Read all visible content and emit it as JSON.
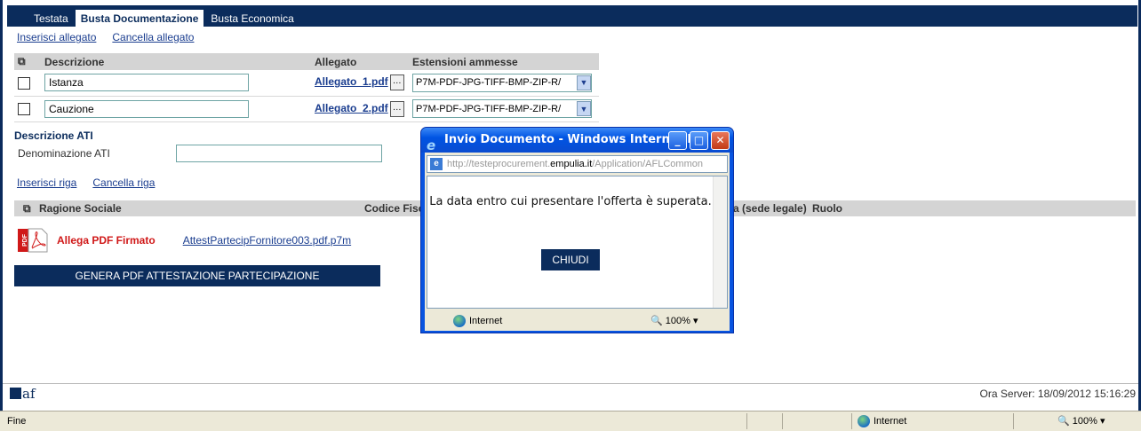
{
  "tabs": [
    {
      "label": "Testata"
    },
    {
      "label": "Busta Documentazione",
      "active": true
    },
    {
      "label": "Busta Economica"
    }
  ],
  "toolbar": {
    "insert_attachment": "Inserisci allegato",
    "delete_attachment": "Cancella allegato"
  },
  "docs_table": {
    "headers": {
      "descrizione": "Descrizione",
      "allegato": "Allegato",
      "estensioni": "Estensioni ammesse"
    },
    "rows": [
      {
        "descrizione": "Istanza",
        "allegato": "Allegato_1.pdf",
        "estensioni": "P7M-PDF-JPG-TIFF-BMP-ZIP-R/"
      },
      {
        "descrizione": "Cauzione",
        "allegato": "Allegato_2.pdf",
        "estensioni": "P7M-PDF-JPG-TIFF-BMP-ZIP-R/"
      }
    ]
  },
  "ati": {
    "section_title": "Descrizione ATI",
    "denominazione_label": "Denominazione ATI",
    "denominazione_value": "",
    "insert_row": "Inserisci riga",
    "delete_row": "Cancella riga",
    "headers": {
      "ragione_sociale": "Ragione Sociale",
      "codice_fiscale": "Codice Fisc",
      "sede": "a (sede legale)",
      "ruolo": "Ruolo"
    }
  },
  "pdf": {
    "label": "Allega PDF Firmato",
    "file": "AttestPartecipFornitore003.pdf.p7m"
  },
  "generate_button": "GENERA PDF ATTESTAZIONE PARTECIPAZIONE",
  "footer": {
    "logo": "af",
    "server_time": "Ora Server: 18/09/2012 15:16:29"
  },
  "statusbar": {
    "status": "Fine",
    "zone": "Internet",
    "zoom": "100%"
  },
  "popup": {
    "title": "Invio Documento - Windows Internet E...",
    "address_prefix": "http://testeprocurement.",
    "address_domain": "empulia.it",
    "address_suffix": "/Application/AFLCommon",
    "message": "La data entro cui presentare l'offerta è superata.",
    "close_button": "CHIUDI",
    "zone": "Internet",
    "zoom": "100%"
  },
  "colors": {
    "navy": "#0b2c5c",
    "link": "#1a3d8f",
    "pdf_red": "#d01818",
    "xp_blue": "#0054e3"
  }
}
